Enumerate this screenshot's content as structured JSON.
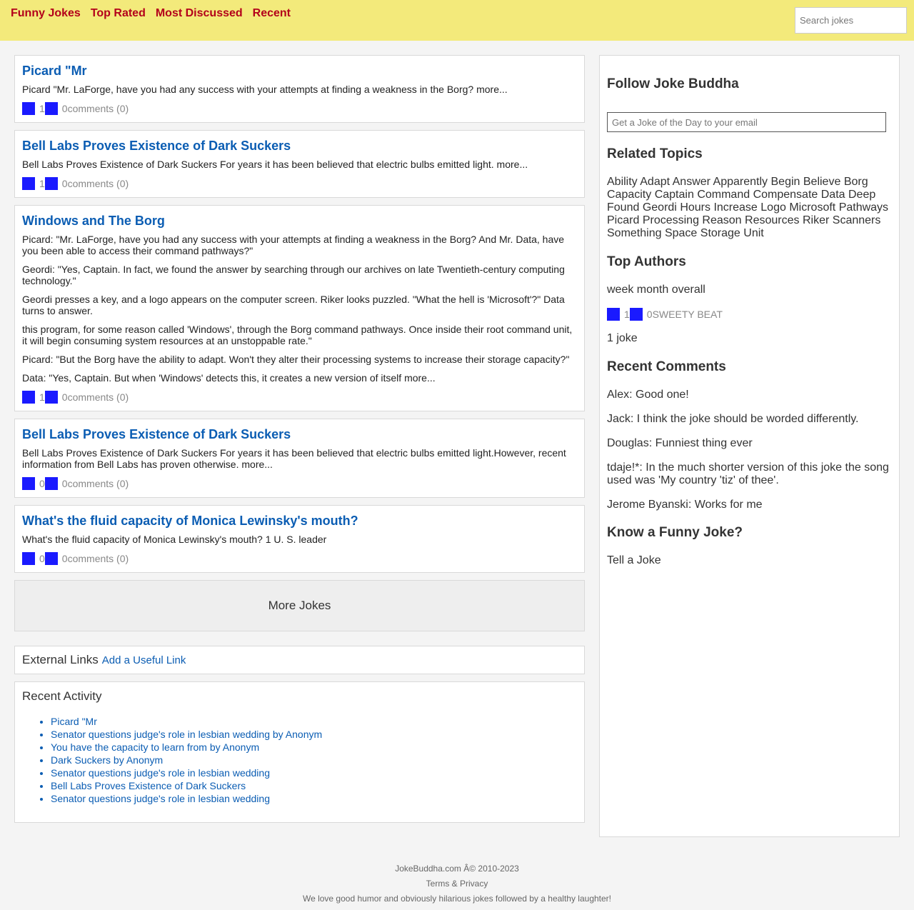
{
  "nav": {
    "items": [
      "Funny Jokes",
      "Top Rated",
      "Most Discussed",
      "Recent"
    ],
    "search_placeholder": "Search jokes"
  },
  "jokes": [
    {
      "title": "Picard \"Mr",
      "paragraphs": [
        "Picard \"Mr. LaForge, have you had any success with your attempts at finding a weakness in the Borg?"
      ],
      "more": "more...",
      "up": "1",
      "down": "0",
      "comments": "comments (0)"
    },
    {
      "title": "Bell Labs Proves Existence of Dark Suckers",
      "paragraphs": [
        "Bell Labs Proves Existence of Dark Suckers For years it has been believed that electric bulbs emitted light."
      ],
      "more": "more...",
      "up": "1",
      "down": "0",
      "comments": "comments (0)"
    },
    {
      "title": "Windows and The Borg",
      "paragraphs": [
        "Picard: \"Mr. LaForge, have you had any success with your attempts at finding a weakness in the Borg? And Mr. Data, have you been able to access their command pathways?\"",
        "Geordi: \"Yes, Captain. In fact, we found the answer by searching through our archives on late Twentieth-century computing technology.\"",
        "Geordi presses a key, and a logo appears on the computer screen. Riker looks puzzled. \"What the hell is 'Microsoft'?\" Data turns to answer.",
        "this program, for some reason called 'Windows', through the Borg command pathways. Once inside their root command unit, it will begin consuming system resources at an unstoppable rate.\"",
        "Picard: \"But the Borg have the ability to adapt. Won't they alter their processing systems to increase their storage capacity?\"",
        "Data: \"Yes, Captain. But when 'Windows' detects this, it creates a new version of itself"
      ],
      "more": "more...",
      "up": "1",
      "down": "0",
      "comments": "comments (0)"
    },
    {
      "title": "Bell Labs Proves Existence of Dark Suckers",
      "paragraphs": [
        "Bell Labs Proves Existence of Dark Suckers For years it has been believed that electric bulbs emitted light.However, recent information from Bell Labs has proven otherwise."
      ],
      "more": "more...",
      "up": "0",
      "down": "0",
      "comments": "comments (0)"
    },
    {
      "title": "What's the fluid capacity of Monica Lewinsky's mouth?",
      "paragraphs": [
        "What's the fluid capacity of Monica Lewinsky's mouth? 1 U. S. leader"
      ],
      "more": "",
      "up": "0",
      "down": "0",
      "comments": "comments (0)"
    }
  ],
  "more_jokes": "More Jokes",
  "external": {
    "title": "External Links",
    "link": "Add a Useful Link"
  },
  "activity": {
    "title": "Recent Activity",
    "items": [
      "Picard \"Mr",
      "Senator questions judge's role in lesbian wedding by Anonym",
      "You have the capacity to learn from by Anonym",
      "Dark Suckers by Anonym",
      "Senator questions judge's role in lesbian wedding",
      "Bell Labs Proves Existence of Dark Suckers",
      "Senator questions judge's role in lesbian wedding"
    ]
  },
  "sidebar": {
    "follow_title": "Follow Joke Buddha",
    "email_placeholder": "Get a Joke of the Day to your email",
    "topics_title": "Related Topics",
    "topics": [
      "Ability",
      "Adapt",
      "Answer",
      "Apparently",
      "Begin",
      "Believe",
      "Borg",
      "Capacity",
      "Captain",
      "Command",
      "Compensate",
      "Data",
      "Deep",
      "Found",
      "Geordi",
      "Hours",
      "Increase",
      "Logo",
      "Microsoft",
      "Pathways",
      "Picard",
      "Processing",
      "Reason",
      "Resources",
      "Riker",
      "Scanners",
      "Something",
      "Space",
      "Storage",
      "Unit"
    ],
    "authors_title": "Top Authors",
    "author_periods": "week month overall",
    "author": {
      "up": "1",
      "down": "0",
      "name": "SWEETY BEAT",
      "jokes": "1 joke"
    },
    "comments_title": "Recent Comments",
    "comments": [
      "Alex: Good one!",
      "Jack: I think the joke should be worded differently.",
      "Douglas: Funniest thing ever",
      "tdaje!*: In the much shorter version of this joke the song used was 'My country 'tiz' of thee'.",
      "Jerome Byanski: Works for me"
    ],
    "tell_title": "Know a Funny Joke?",
    "tell_link": "Tell a Joke"
  },
  "footer": {
    "copyright": "JokeBuddha.com Â© 2010-2023",
    "links": "Terms & Privacy",
    "tagline": "We love good humor and obviously hilarious jokes followed by a healthy laughter!"
  },
  "colors": {
    "header_bg": "#f3ea7b",
    "nav_link": "#b3001b",
    "link": "#0b5db3",
    "vote_box": "#1a1aff"
  }
}
